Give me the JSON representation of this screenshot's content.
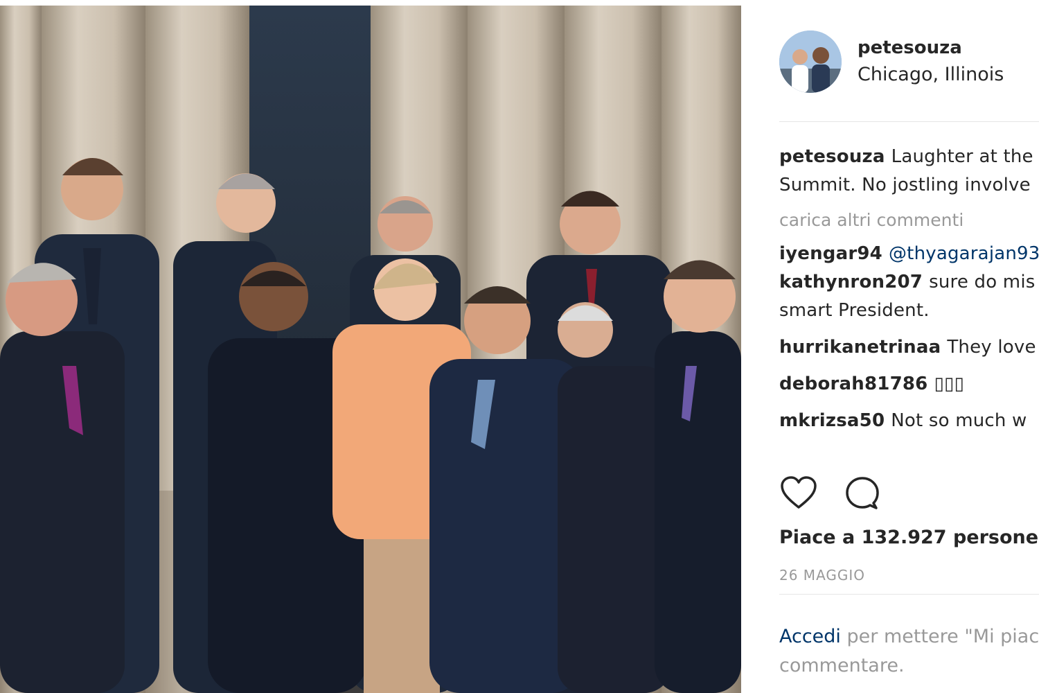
{
  "post": {
    "username": "petesouza",
    "location": "Chicago, Illinois",
    "caption": {
      "user": "petesouza",
      "line1": "Laughter at the",
      "line2": "Summit. No jostling involve"
    },
    "load_more": "carica altri commenti",
    "comments": [
      {
        "user": "iyengar94",
        "text": "@thyagarajan93"
      },
      {
        "user": "kathynron207",
        "text": "sure do mis",
        "text2": "smart President."
      },
      {
        "user": "hurrikanetrinaa",
        "text": "They love"
      },
      {
        "user": "deborah81786",
        "text": "▯▯▯"
      },
      {
        "user": "mkrizsa50",
        "text": "Not so much w"
      }
    ],
    "likes": "Piace a 132.927 persone",
    "date": "26 MAGGIO",
    "login": {
      "link": "Accedi",
      "rest": "per mettere \"Mi piac",
      "line2": "commentare."
    }
  },
  "icons": {
    "like": "heart-icon",
    "comment": "comment-bubble-icon"
  },
  "colors": {
    "link": "#003569",
    "muted": "#999999",
    "text": "#262626"
  }
}
